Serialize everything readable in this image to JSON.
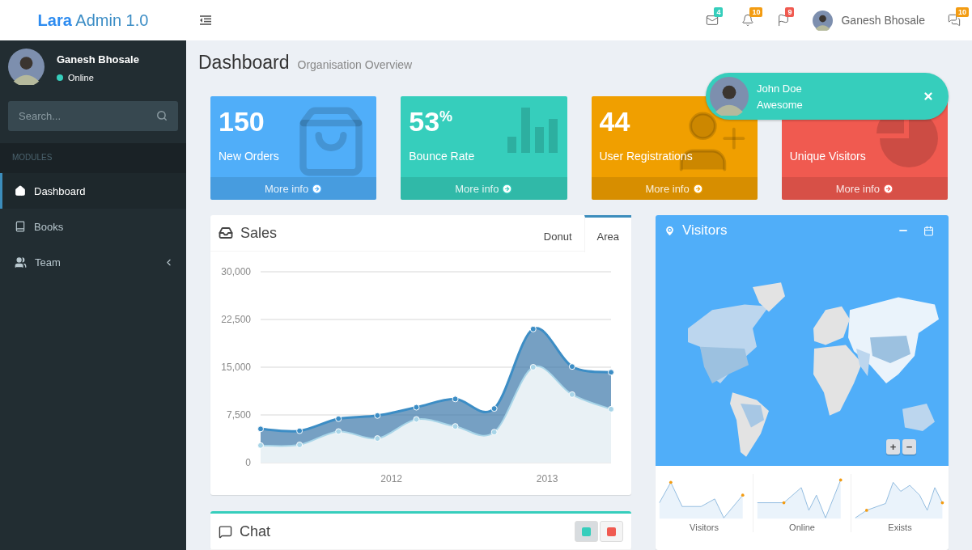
{
  "header": {
    "logo": "**Lara** Admin 1.0",
    "notifications": [
      {
        "kind": "mail",
        "badge": "4",
        "color": "#36cebc"
      },
      {
        "kind": "bell",
        "badge": "10",
        "color": "#f39c12"
      },
      {
        "kind": "flag",
        "badge": "9",
        "color": "#f05a50"
      }
    ],
    "user_name": "Ganesh Bhosale",
    "messages": {
      "badge": "10",
      "color": "#f39c12"
    }
  },
  "sidebar": {
    "user": {
      "name": "Ganesh Bhosale",
      "status": {
        "label": "Online",
        "color": "#36cebc"
      }
    },
    "search": {
      "placeholder": "Search..."
    },
    "section": "MODULES",
    "items": [
      {
        "label": "Dashboard",
        "kind": "home",
        "selected": true,
        "expandable": false
      },
      {
        "label": "Books",
        "kind": "book",
        "selected": false,
        "expandable": false
      },
      {
        "label": "Team",
        "kind": "team",
        "selected": false,
        "expandable": true
      }
    ]
  },
  "page": {
    "title": "Dashboard",
    "subtitle": "Organisation Overview"
  },
  "stats": [
    {
      "value": "150",
      "label": "New Orders",
      "link": "More info",
      "color": "#50aef9",
      "kind": "bag"
    },
    {
      "value": "53$^{%}$",
      "label": "Bounce Rate",
      "link": "More info",
      "color": "#36cebc",
      "kind": "bars"
    },
    {
      "value": "44",
      "label": "User Registrations",
      "link": "More info",
      "color": "#f09f00",
      "kind": "user-add"
    },
    {
      "label": "Unique Visitors",
      "link": "More info",
      "color": "#f05a50",
      "kind": "pie"
    }
  ],
  "toast": {
    "name": "John Doe",
    "message": "Awesome"
  },
  "sales": {
    "title": "Sales",
    "tabs": [
      {
        "label": "Donut",
        "selected": false
      },
      {
        "label": "Area",
        "selected": true
      }
    ],
    "chart_data": {
      "type": "area",
      "x": [
        2011.16,
        2011.41,
        2011.66,
        2011.91,
        2012.16,
        2012.41,
        2012.66,
        2012.91,
        2013.16,
        2013.41
      ],
      "series": [
        {
          "color": "#3c8dc5",
          "values": [
            5300,
            5000,
            6900,
            7400,
            8700,
            10000,
            8500,
            21000,
            15100,
            14200
          ]
        },
        {
          "color": "#a8d5e8",
          "values": [
            2700,
            2800,
            4900,
            3800,
            6800,
            5700,
            4800,
            15000,
            10700,
            8400
          ]
        }
      ],
      "xlim": [
        2011.16,
        2013.41
      ],
      "ylim": [
        0,
        30000
      ],
      "grid": true,
      "xticks": [
        2012,
        2013
      ],
      "yticks": [
        {
          "value": 0,
          "label": "0"
        },
        {
          "value": 7500,
          "label": "7,500"
        },
        {
          "value": 15000,
          "label": "15,000"
        },
        {
          "value": 22500,
          "label": "22,500"
        },
        {
          "value": 30000,
          "label": "30,000"
        }
      ]
    }
  },
  "visitors": {
    "title": "Visitors",
    "map": {
      "kind": "picture"
    },
    "zoom": [
      "+",
      "−"
    ],
    "sparklines": [
      {
        "label": "Visitors"
      },
      {
        "label": "Online"
      },
      {
        "label": "Exists"
      }
    ]
  },
  "chat": {
    "title": "Chat",
    "buttons": [
      {
        "color": "#36cebc",
        "selected": true
      },
      {
        "color": "#f05a50",
        "selected": false
      }
    ]
  }
}
